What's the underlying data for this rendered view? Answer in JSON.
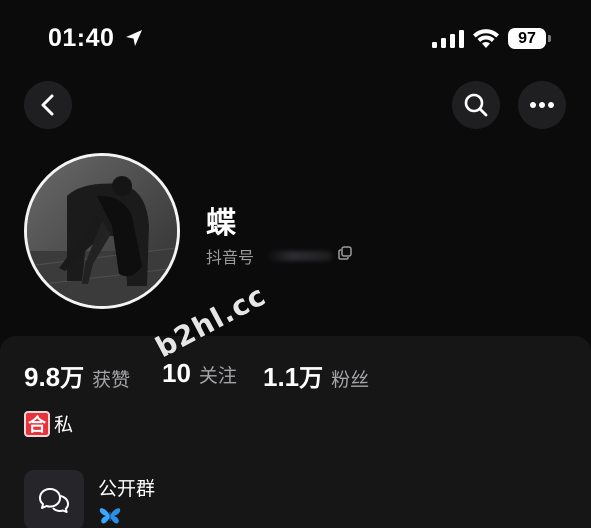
{
  "status_bar": {
    "time": "01:40",
    "battery": "97",
    "icons": [
      "location-arrow-icon",
      "signal-icon",
      "wifi-icon",
      "battery-icon"
    ]
  },
  "nav": {
    "icons": [
      "back-chevron-icon",
      "search-icon",
      "more-dots-icon"
    ]
  },
  "profile": {
    "nickname": "蝶",
    "douyin_id_label": "抖音号",
    "copy_icon": "copy-icon"
  },
  "stats": {
    "likes": {
      "number": "9.8",
      "unit": "万",
      "label": "获赞"
    },
    "following": {
      "number": "10",
      "label": "关注"
    },
    "followers": {
      "number": "1.1",
      "unit": "万",
      "label": "粉丝"
    }
  },
  "watermark": "b2hl.cc",
  "bio": {
    "badge": "合",
    "text": "私"
  },
  "group": {
    "title": "公开群",
    "icon": "chat-bubbles-icon",
    "sub_icon": "butterfly-icon"
  },
  "colors": {
    "background": "#0b0b0c",
    "sheet": "#161616",
    "muted_text": "#a4a4a8",
    "badge_red": "#e8333b",
    "butterfly_blue": "#3aa6ff"
  }
}
